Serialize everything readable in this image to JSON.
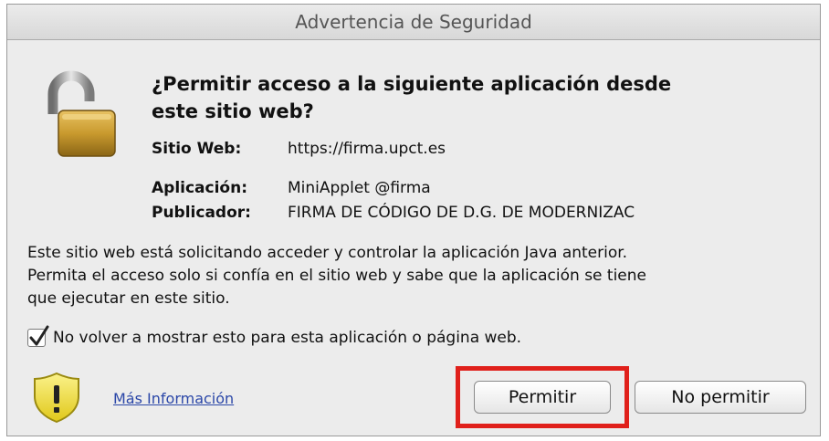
{
  "window": {
    "title": "Advertencia de Seguridad"
  },
  "prompt": {
    "heading_line1": "¿Permitir acceso a la siguiente aplicación desde",
    "heading_line2": "este sitio web?"
  },
  "details": {
    "site_label": "Sitio Web:",
    "site_value": "https://firma.upct.es",
    "app_label": "Aplicación:",
    "app_value": "MiniApplet @firma",
    "publisher_label": "Publicador:",
    "publisher_value": "FIRMA DE CÓDIGO DE D.G. DE MODERNIZAC"
  },
  "message": {
    "line1": "Este sitio web está solicitando acceder y controlar la aplicación Java anterior.",
    "line2": "Permita el acceso solo si confía en el sitio web y sabe que la aplicación se tiene",
    "line3": "que ejecutar en este sitio."
  },
  "dont_show_again": {
    "label": "No volver a mostrar esto para esta aplicación o página web.",
    "checked": true
  },
  "footer": {
    "more_info_label": "Más Información",
    "allow_label": "Permitir",
    "deny_label": "No permitir"
  },
  "icons": {
    "lock": "open-padlock-icon",
    "warning": "warning-shield-icon",
    "check": "checkmark-icon"
  },
  "colors": {
    "highlight": "#e0201b",
    "link": "#2b47a8",
    "lock_gold": "#c99a2e",
    "shield_yellow": "#f2e12a"
  }
}
